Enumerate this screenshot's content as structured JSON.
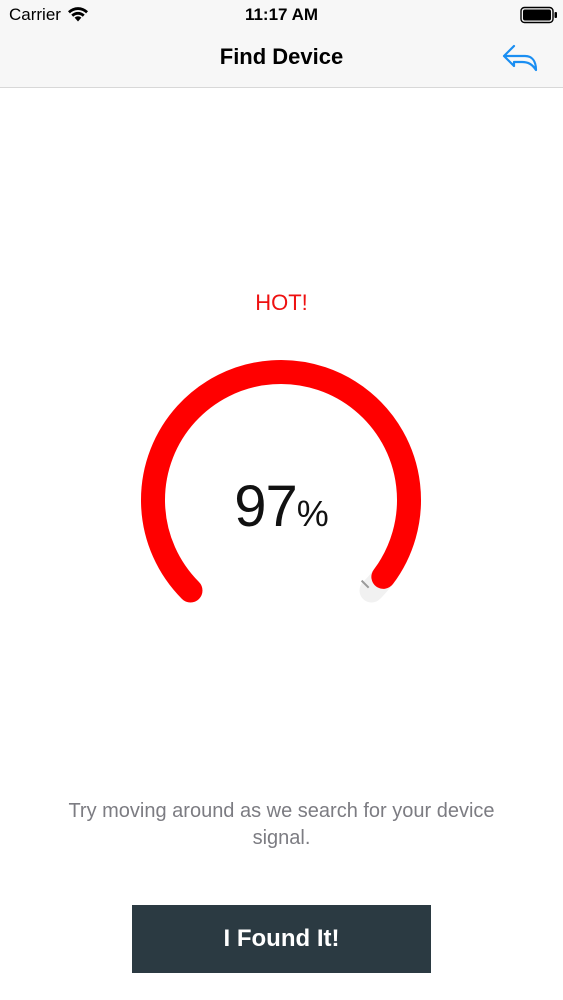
{
  "status_bar": {
    "carrier": "Carrier",
    "time": "11:17 AM",
    "wifi_icon": "wifi-icon",
    "battery_icon": "battery-icon"
  },
  "nav": {
    "title": "Find Device",
    "back_icon": "reply-arrow-icon"
  },
  "signal": {
    "status": "HOT!",
    "percent_value": "97",
    "percent_sign": "%",
    "fraction": 0.97,
    "status_color": "#ee1111",
    "gauge_color": "#ff0000"
  },
  "hint": "Try moving around as we search for your device signal.",
  "actions": {
    "found_label": "I Found It!"
  },
  "colors": {
    "accent": "#1a8ef2",
    "button_bg": "#2b3a42",
    "hint_text": "#7c7c82"
  }
}
